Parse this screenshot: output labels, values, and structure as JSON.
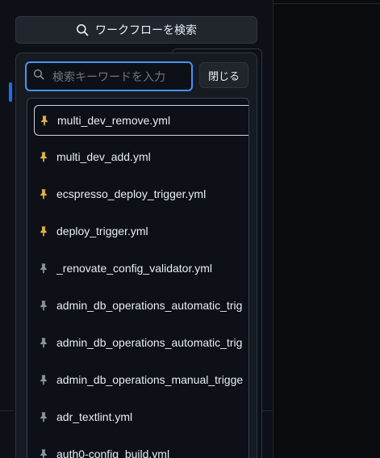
{
  "search_workflows_button": {
    "label": "ワークフローを検索",
    "icon": "search-icon"
  },
  "filter": {
    "placeholder": "検索キーワードを入力",
    "value": "",
    "icon": "search-icon"
  },
  "close_button": {
    "label": "閉じる"
  },
  "workflows": [
    {
      "name": "multi_dev_remove.yml",
      "pinned": true,
      "selected": true
    },
    {
      "name": "multi_dev_add.yml",
      "pinned": true,
      "selected": false
    },
    {
      "name": "ecspresso_deploy_trigger.yml",
      "pinned": true,
      "selected": false
    },
    {
      "name": "deploy_trigger.yml",
      "pinned": true,
      "selected": false
    },
    {
      "name": "_renovate_config_validator.yml",
      "pinned": false,
      "selected": false
    },
    {
      "name": "admin_db_operations_automatic_trig",
      "pinned": false,
      "selected": false
    },
    {
      "name": "admin_db_operations_automatic_trig",
      "pinned": false,
      "selected": false
    },
    {
      "name": "admin_db_operations_manual_trigge",
      "pinned": false,
      "selected": false
    },
    {
      "name": "adr_textlint.yml",
      "pinned": false,
      "selected": false
    },
    {
      "name": "auth0-config_build.yml",
      "pinned": false,
      "selected": false
    }
  ],
  "colors": {
    "pin_active": "#e3b341",
    "pin_inactive": "#8b949e",
    "focus_ring": "#4493f8",
    "accent": "#1f6feb"
  }
}
